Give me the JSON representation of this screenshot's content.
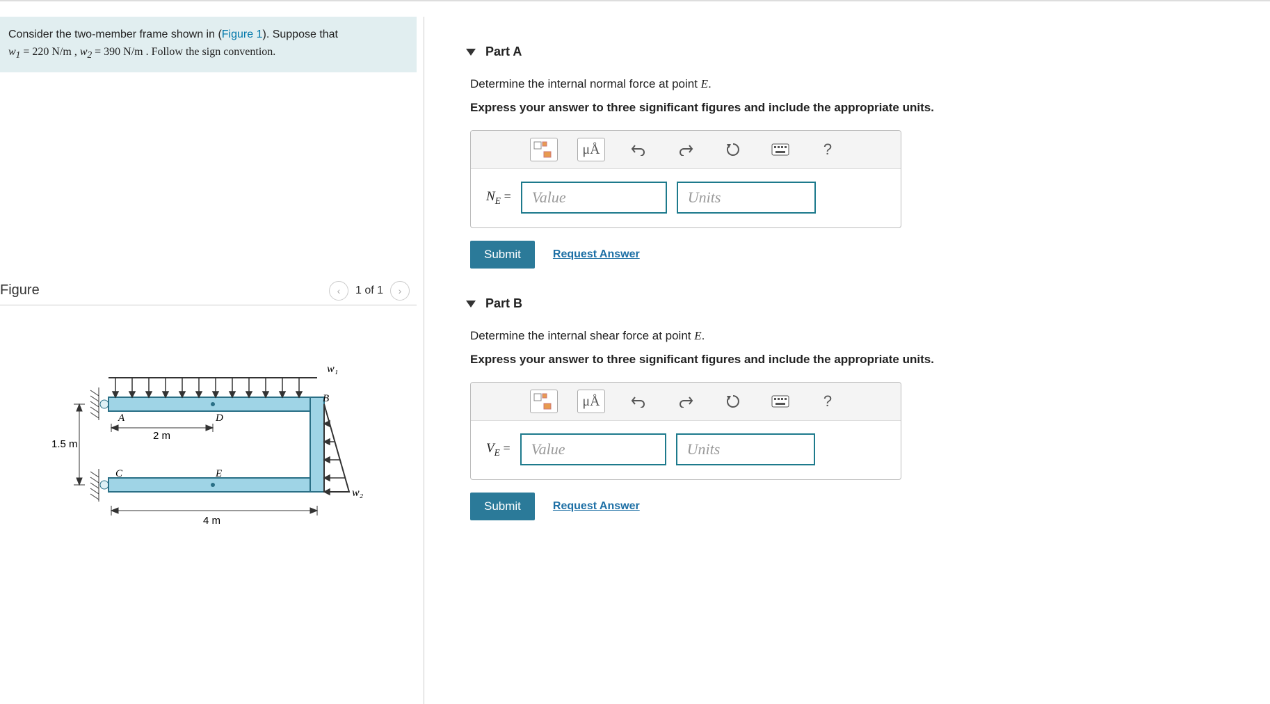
{
  "problem": {
    "text_1": "Consider the two-member frame shown in (",
    "figure_link": "Figure 1",
    "text_2": "). Suppose that",
    "text_3": " = 220  N/m , ",
    "text_4": " = 390  N/m . Follow the sign convention.",
    "w1": "w",
    "w1_sub": "1",
    "w2": "w",
    "w2_sub": "2"
  },
  "figure": {
    "title": "Figure",
    "pager": "1 of 1",
    "labels": {
      "w1": "w₁",
      "w2": "w₂",
      "A": "A",
      "B": "B",
      "C": "C",
      "D": "D",
      "E": "E",
      "dim_1_5": "1.5 m",
      "dim_2": "2 m",
      "dim_4": "4 m"
    }
  },
  "parts": {
    "a": {
      "title": "Part A",
      "prompt1_a": "Determine the internal normal force at point ",
      "prompt1_var": "E",
      "prompt1_b": ".",
      "prompt2": "Express your answer to three significant figures and include the appropriate units.",
      "var_letter": "N",
      "var_sub": "E",
      "eq": "=",
      "value_ph": "Value",
      "units_ph": "Units",
      "submit": "Submit",
      "request": "Request Answer"
    },
    "b": {
      "title": "Part B",
      "prompt1_a": "Determine the internal shear force at point ",
      "prompt1_var": "E",
      "prompt1_b": ".",
      "prompt2": "Express your answer to three significant figures and include the appropriate units.",
      "var_letter": "V",
      "var_sub": "E",
      "eq": "=",
      "value_ph": "Value",
      "units_ph": "Units",
      "submit": "Submit",
      "request": "Request Answer"
    }
  },
  "toolbar": {
    "mu_label": "μÅ",
    "help_label": "?"
  }
}
